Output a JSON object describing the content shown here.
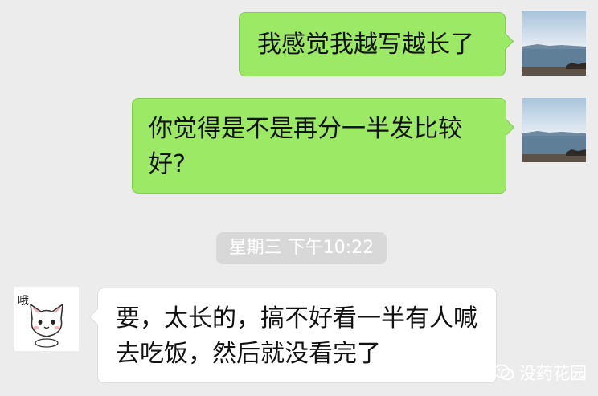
{
  "messages": [
    {
      "side": "sent",
      "text": "我感觉我越写越长了"
    },
    {
      "side": "sent",
      "text": "你觉得是不是再分一半发比较好?"
    },
    {
      "side": "received",
      "text": "要，太长的，搞不好看一半有人喊去吃饭，然后就没看完了"
    }
  ],
  "timestamp": "星期三 下午10:22",
  "contact_avatar": {
    "label": "哦",
    "icon": "cat-sticker-icon"
  },
  "self_avatar": {
    "icon": "seaside-photo-icon"
  },
  "watermark": {
    "text": "没药花园",
    "icon": "wechat-icon"
  },
  "colors": {
    "background": "#ececec",
    "sent_bubble": "#9ce965",
    "received_bubble": "#ffffff",
    "timestamp_pill": "#d8d8d8"
  }
}
